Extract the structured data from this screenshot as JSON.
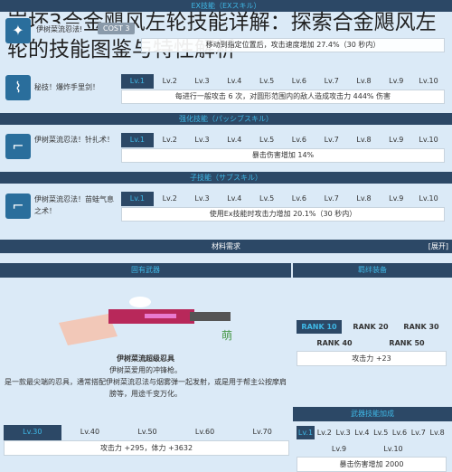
{
  "title": "崩坏3合金飓风左轮技能详解：探索合金飓风左轮的技能图鉴与特性解析",
  "headers": {
    "ex": "EX技能（EXスキル）",
    "passive": "强化技能（パッシブスキル）",
    "sub": "子技能（サブスキル）",
    "materials": "材料需求",
    "expand": "[展开]",
    "weapon": "固有武器",
    "gear": "羁绊装备",
    "weapon_skill": "武器技能加成"
  },
  "levels": [
    "Lv.1",
    "Lv.2",
    "Lv.3",
    "Lv.4",
    "Lv.5",
    "Lv.6",
    "Lv.7",
    "Lv.8",
    "Lv.9",
    "Lv.10"
  ],
  "skills": [
    {
      "name": "伊树菜流忍法!",
      "cost": "COST 3",
      "desc": "移动到指定位置后，攻击速度增加 27.4%（30 秒内）"
    },
    {
      "name": "秘技！爆炸手里剑！",
      "desc": "每进行一般攻击 6 次，对圆形范围内的敌人造成攻击力 444% 伤害"
    },
    {
      "name": "伊树菜流忍法！针扎术！",
      "desc": "暴击伤害增加 14%"
    },
    {
      "name": "伊树菜流忍法！苗蛙气息之术！",
      "desc": "使用Ex技能时攻击力增加 20.1%（30 秒内）"
    }
  ],
  "weapon": {
    "name": "伊树菜流超级忍具",
    "desc1": "伊树菜爱用的冲锋枪。",
    "desc2": "是一款最尖端的忍具，通常搭配伊树菜流忍法与烟雾弹一起发射，或是用于帮主公按摩肩膀等，用途千变万化。",
    "watermark": "萌",
    "levels": [
      "Lv.30",
      "Lv.40",
      "Lv.50",
      "Lv.60",
      "Lv.70"
    ],
    "stat": "攻击力 +295，体力 +3632"
  },
  "gear": {
    "ranks": [
      "RANK 10",
      "RANK 20",
      "RANK 30",
      "RANK 40",
      "RANK 50"
    ],
    "stat": "攻击力 +23"
  },
  "weapon_skill": {
    "stat": "暴击伤害增加 2000"
  },
  "colors": {
    "header": "#2c4866",
    "accent": "#3fb8e6",
    "bg": "#dbeaf7"
  }
}
